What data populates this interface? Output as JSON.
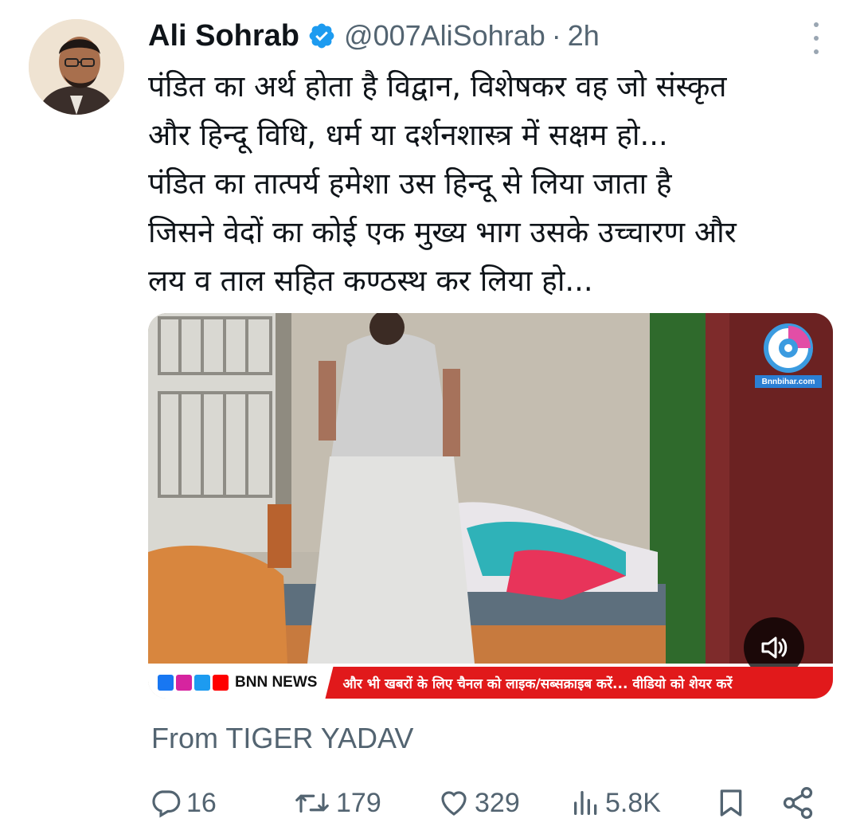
{
  "tweet": {
    "author_name": "Ali Sohrab",
    "handle": "@007AliSohrab",
    "separator": "·",
    "time": "2h",
    "text_lines": [
      "पंडित का अर्थ होता है विद्वान, विशेषकर वह जो संस्कृत",
      "और हिन्दू विधि, धर्म या दर्शनशास्त्र में सक्षम हो...",
      "पंडित का तात्पर्य हमेशा उस हिन्दू से लिया जाता है",
      "जिसने वेदों का कोई एक मुख्य भाग उसके उच्चारण और",
      "लय व ताल सहित कण्ठस्थ कर लिया हो..."
    ],
    "source_credit": "From TIGER YADAV"
  },
  "media": {
    "channel_name": "BNN NEWS",
    "ticker_text": "और भी खबरों के लिए चैनल को लाइक/सब्सक्राइब करें... वीडियो को शेयर करें",
    "logo_label": "BNN NEWS",
    "logo_site": "Bnnbihar.com",
    "sound_icon": "volume-muted-icon"
  },
  "actions": {
    "reply_count": "16",
    "retweet_count": "179",
    "like_count": "329",
    "views_count": "5.8K"
  },
  "colors": {
    "text": "#0f1419",
    "muted": "#536471",
    "verified": "#1d9bf0",
    "ticker_red": "#e1191b"
  }
}
